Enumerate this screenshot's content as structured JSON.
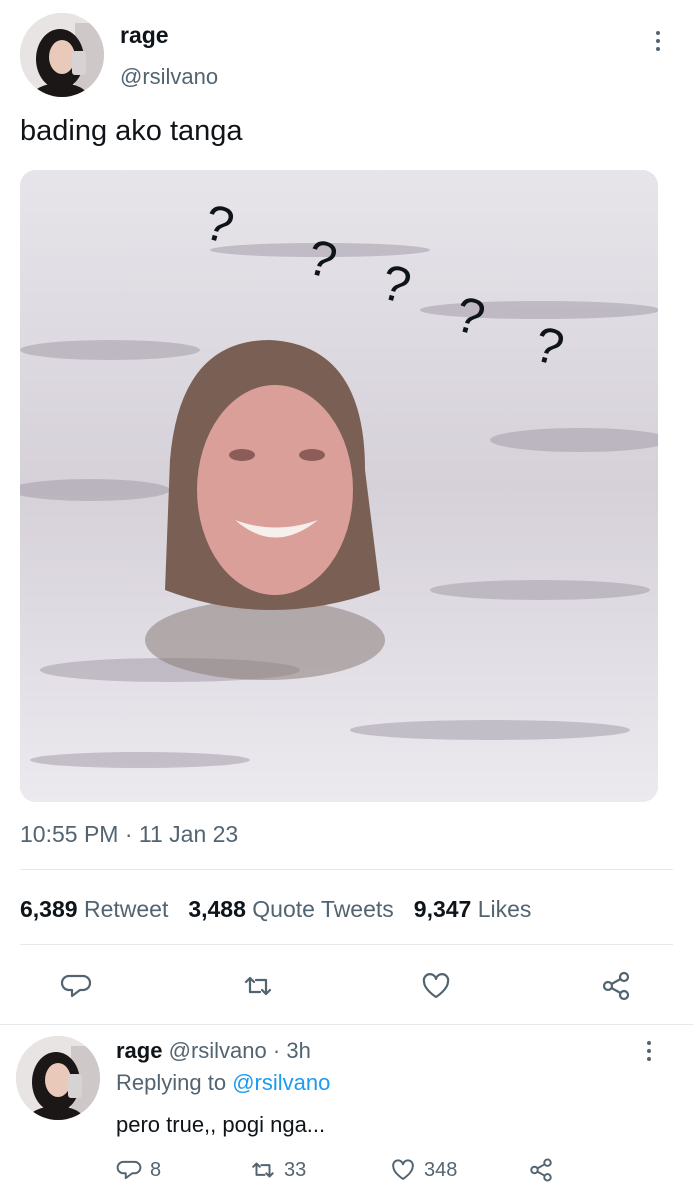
{
  "tweet": {
    "author_name": "rage",
    "author_handle": "@rsilvano",
    "text": "bading ako tanga",
    "time": "10:55 PM",
    "separator": "·",
    "date": "11 Jan 23",
    "image_annotation": "?",
    "stats": {
      "retweets_count": "6,389",
      "retweets_label": "Retweet",
      "quotes_count": "3,488",
      "quotes_label": "Quote Tweets",
      "likes_count": "9,347",
      "likes_label": "Likes"
    },
    "actions": [
      "reply-icon",
      "retweet-icon",
      "like-icon",
      "share-icon"
    ]
  },
  "reply": {
    "author_name": "rage",
    "author_handle": "@rsilvano",
    "separator": "·",
    "time_ago": "3h",
    "replying_prefix": "Replying to",
    "replying_to": "@rsilvano",
    "text": "pero true,, pogi nga...",
    "reply_count": "8",
    "retweet_count": "33",
    "like_count": "348"
  },
  "colors": {
    "accent": "#1d9bf0",
    "secondary_text": "#536471",
    "primary_text": "#0f1419",
    "divider": "#e6e9ec"
  }
}
